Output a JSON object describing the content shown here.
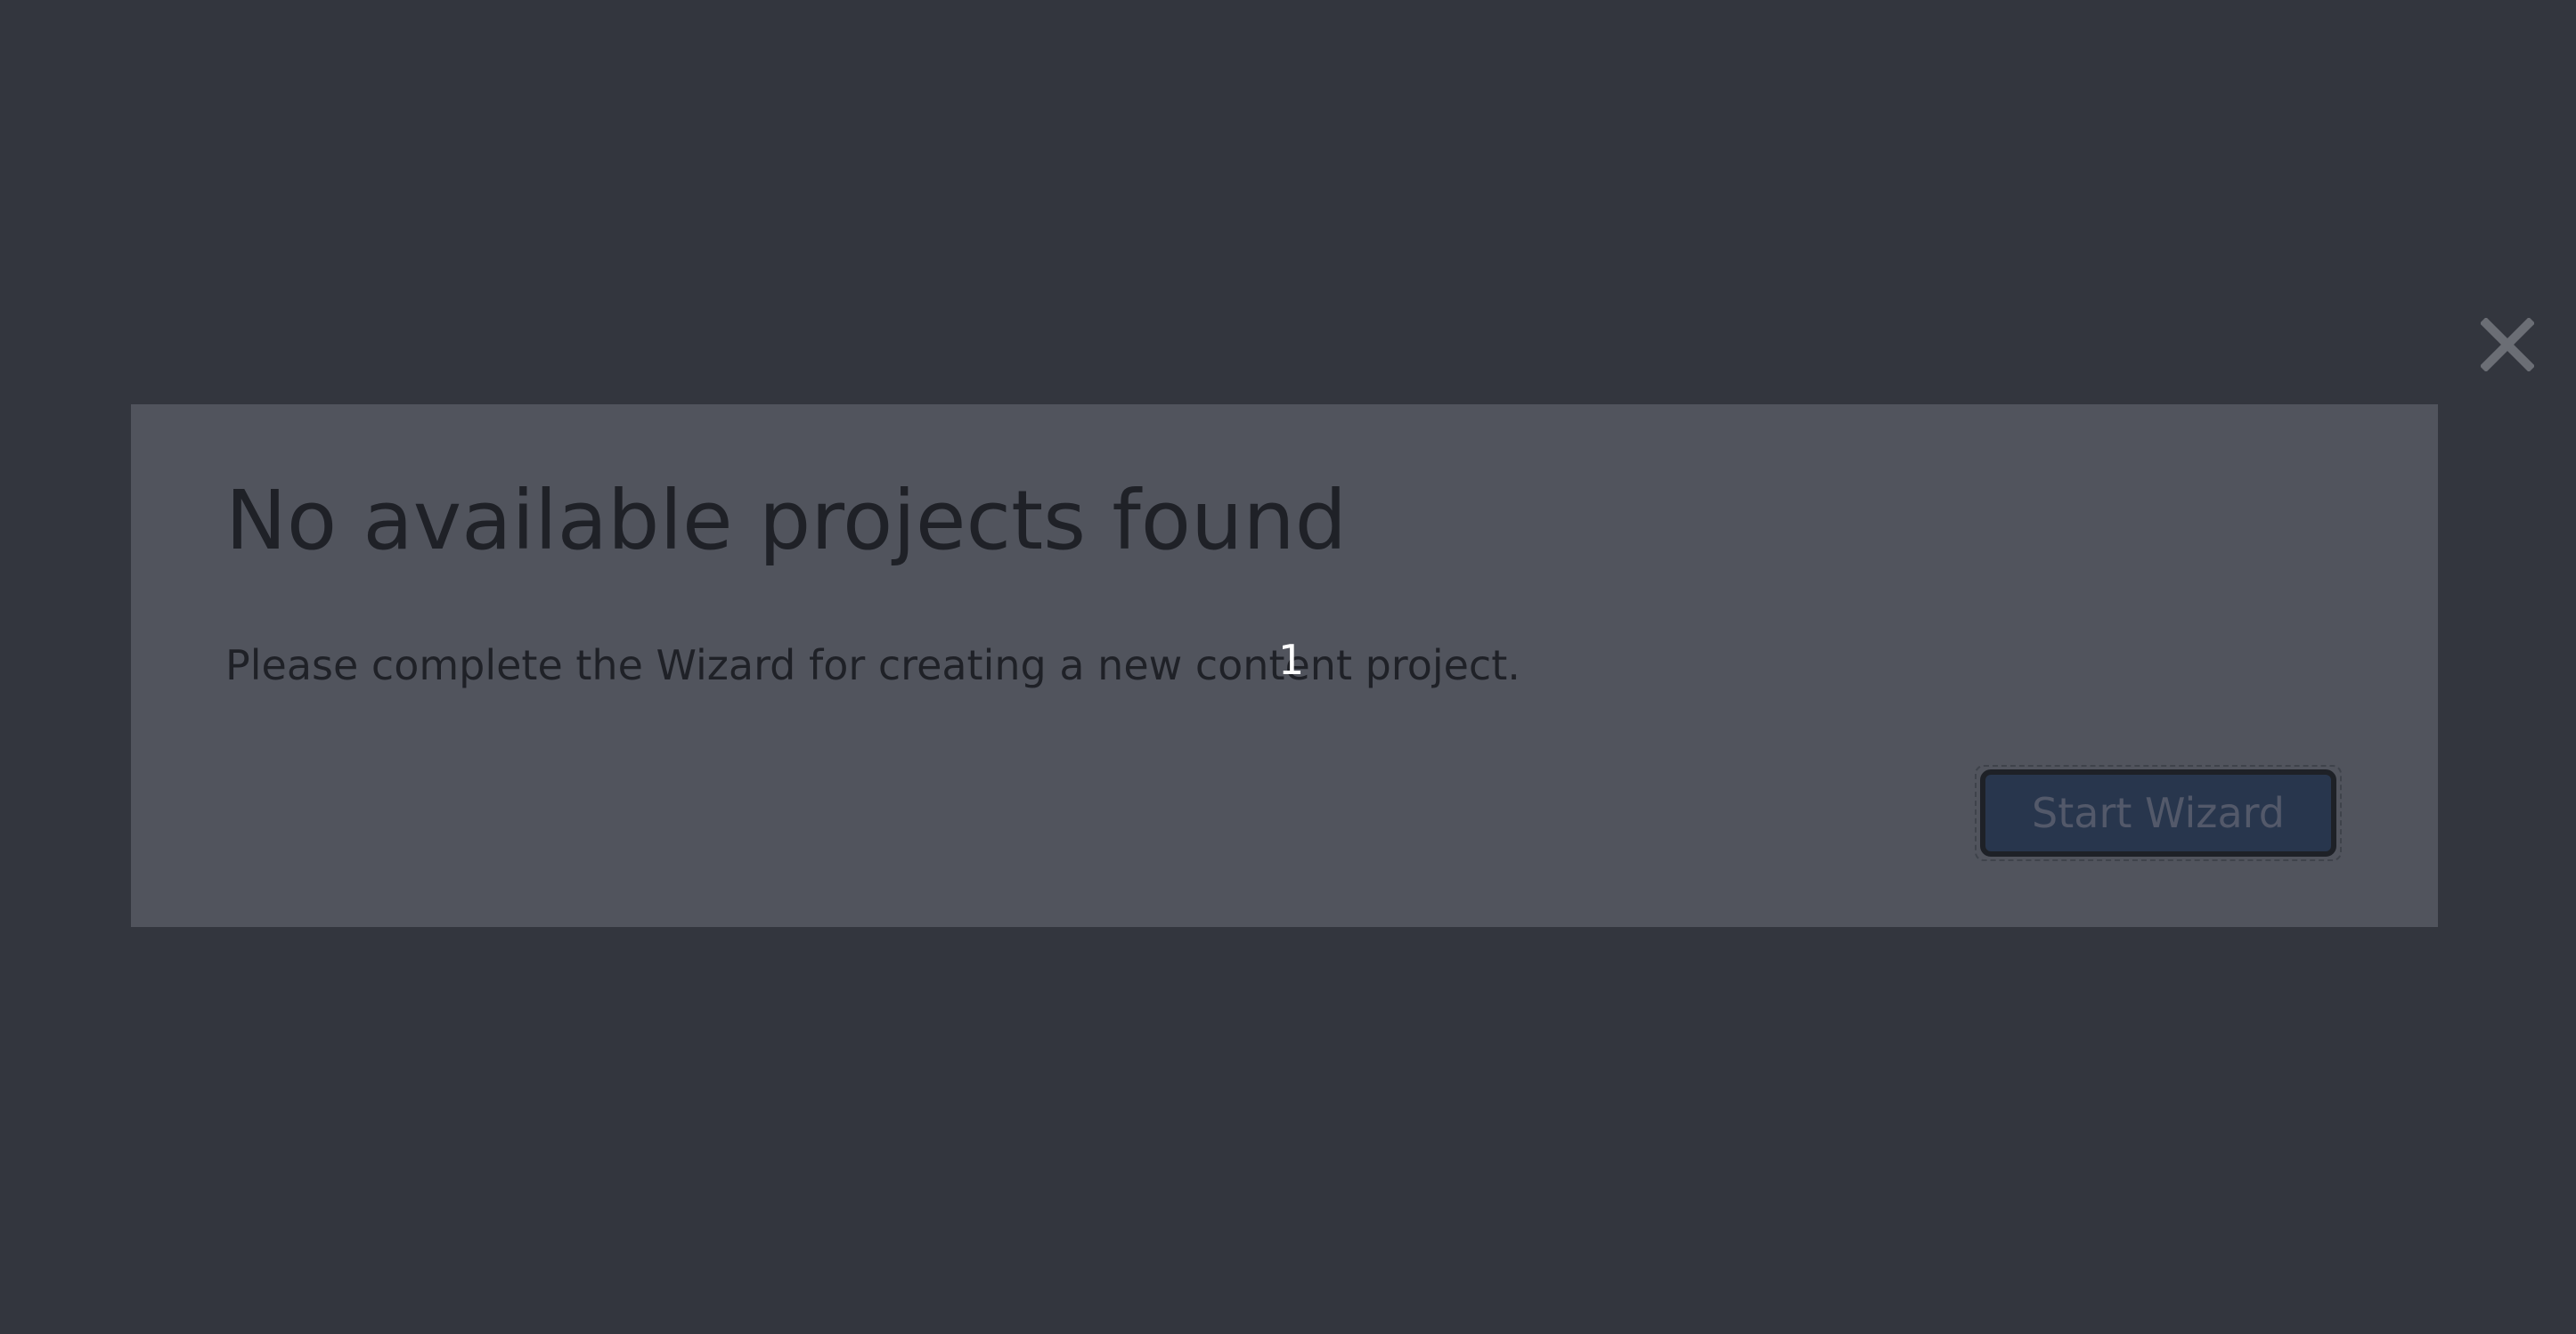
{
  "dialog": {
    "title": "No available projects found",
    "message": "Please complete the Wizard for creating a new content project.",
    "primary_button_label": "Start Wizard",
    "close_icon": "close-icon"
  },
  "overlay": {
    "marker_label": "1"
  },
  "colors": {
    "backdrop": "#33363e",
    "dialog_background": "#51545d",
    "text": "#1f2127",
    "button_background": "#28364d",
    "button_text": "#53596a",
    "close_icon": "#6b6e75",
    "marker_text": "#ffffff"
  }
}
